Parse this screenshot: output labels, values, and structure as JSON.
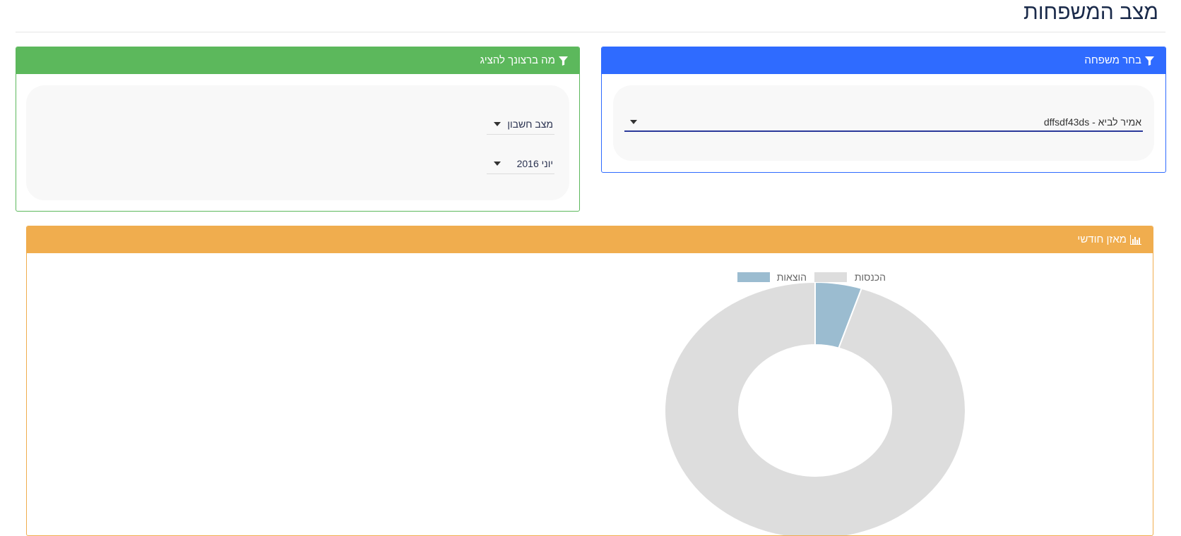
{
  "page": {
    "title": "מצב המשפחות"
  },
  "family_panel": {
    "header": "בחר משפחה",
    "icon": "filter-icon",
    "selected_family": "אמיר לביא - dffsdf43ds"
  },
  "options_panel": {
    "header": "מה ברצונך להציג",
    "icon": "filter-icon",
    "view_select": "מצב חשבון",
    "month_select": "יוני 2016"
  },
  "chart_panel": {
    "header": "מאזן חודשי",
    "icon": "bar-chart-icon"
  },
  "chart_data": {
    "type": "pie",
    "categories": [
      "הוצאות",
      "הכנסות"
    ],
    "values": [
      5,
      95
    ],
    "colors": [
      "#9bbcd0",
      "#dddddd"
    ],
    "legend": "top",
    "donut": true
  }
}
